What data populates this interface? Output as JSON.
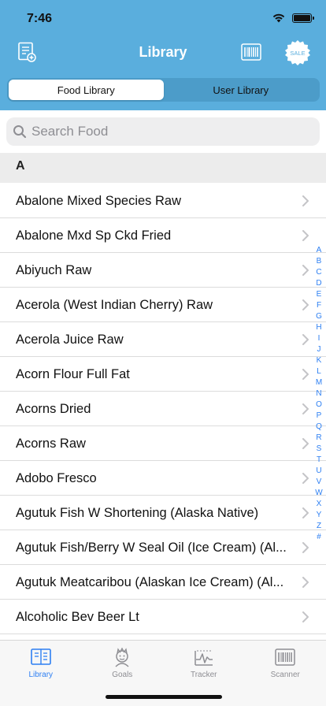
{
  "status": {
    "time": "7:46"
  },
  "nav": {
    "title": "Library",
    "sale_label": "SALE",
    "colors": {
      "header_bg": "#5aaedd",
      "accent": "#2d7ff2"
    }
  },
  "segments": [
    {
      "label": "Food Library",
      "active": true
    },
    {
      "label": "User Library",
      "active": false
    }
  ],
  "search": {
    "placeholder": "Search Food"
  },
  "section": {
    "letter": "A"
  },
  "items": [
    {
      "label": "Abalone Mixed Species Raw"
    },
    {
      "label": "Abalone Mxd Sp Ckd Fried"
    },
    {
      "label": "Abiyuch Raw"
    },
    {
      "label": "Acerola (West Indian Cherry) Raw"
    },
    {
      "label": "Acerola Juice Raw"
    },
    {
      "label": "Acorn Flour Full Fat"
    },
    {
      "label": "Acorns Dried"
    },
    {
      "label": "Acorns Raw"
    },
    {
      "label": "Adobo Fresco"
    },
    {
      "label": "Agutuk Fish W Shortening (Alaska Native)"
    },
    {
      "label": "Agutuk Fish/Berry W Seal Oil (Ice Cream) (Al..."
    },
    {
      "label": "Agutuk Meatcaribou (Alaskan Ice Cream) (Al..."
    },
    {
      "label": "Alcoholic Bev Beer Lt"
    }
  ],
  "index_letters": [
    "A",
    "B",
    "C",
    "D",
    "E",
    "F",
    "G",
    "H",
    "I",
    "J",
    "K",
    "L",
    "M",
    "N",
    "O",
    "P",
    "Q",
    "R",
    "S",
    "T",
    "U",
    "V",
    "W",
    "X",
    "Y",
    "Z",
    "#"
  ],
  "tabs": [
    {
      "label": "Library",
      "icon": "library-book-icon",
      "active": true
    },
    {
      "label": "Goals",
      "icon": "goals-head-icon",
      "active": false
    },
    {
      "label": "Tracker",
      "icon": "tracker-chart-icon",
      "active": false
    },
    {
      "label": "Scanner",
      "icon": "scanner-barcode-icon",
      "active": false
    }
  ]
}
